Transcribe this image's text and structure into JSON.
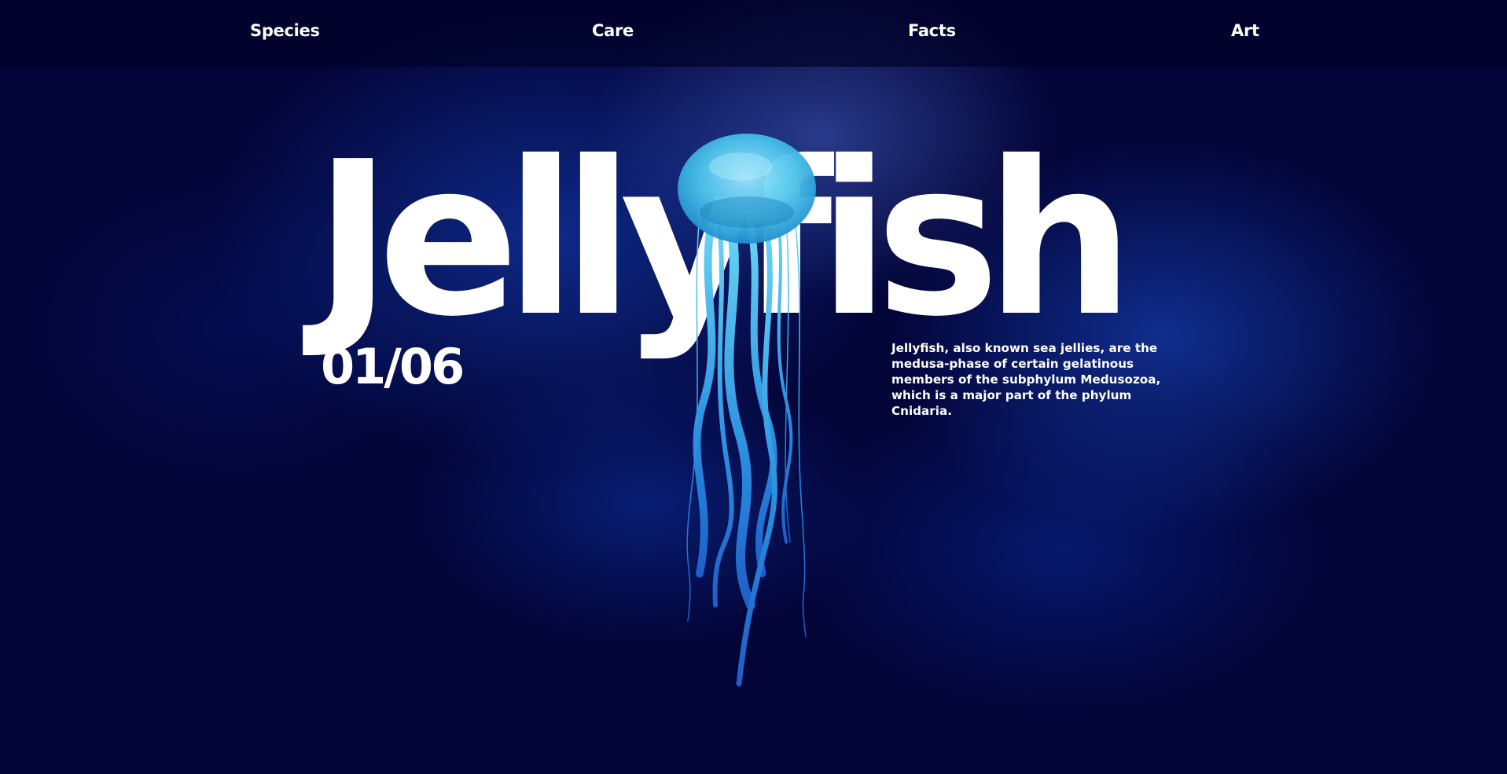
{
  "nav": {
    "items": [
      {
        "label": "Species"
      },
      {
        "label": "Care"
      },
      {
        "label": "Facts"
      },
      {
        "label": "Art"
      }
    ]
  },
  "hero": {
    "title": "Jellyfish",
    "counter": "01/06",
    "description": "Jellyfish, also known sea jellies, are the medusa-phase of certain gelatinous members of the subphylum Medusozoa, which is a major part of the phylum Cnidaria."
  },
  "colors": {
    "background": "#030438",
    "accent_blue": "#1a3a9c",
    "jelly_cyan": "#4fc6ec",
    "text": "#ffffff"
  },
  "icons": {
    "jellyfish": "jellyfish-illustration"
  }
}
